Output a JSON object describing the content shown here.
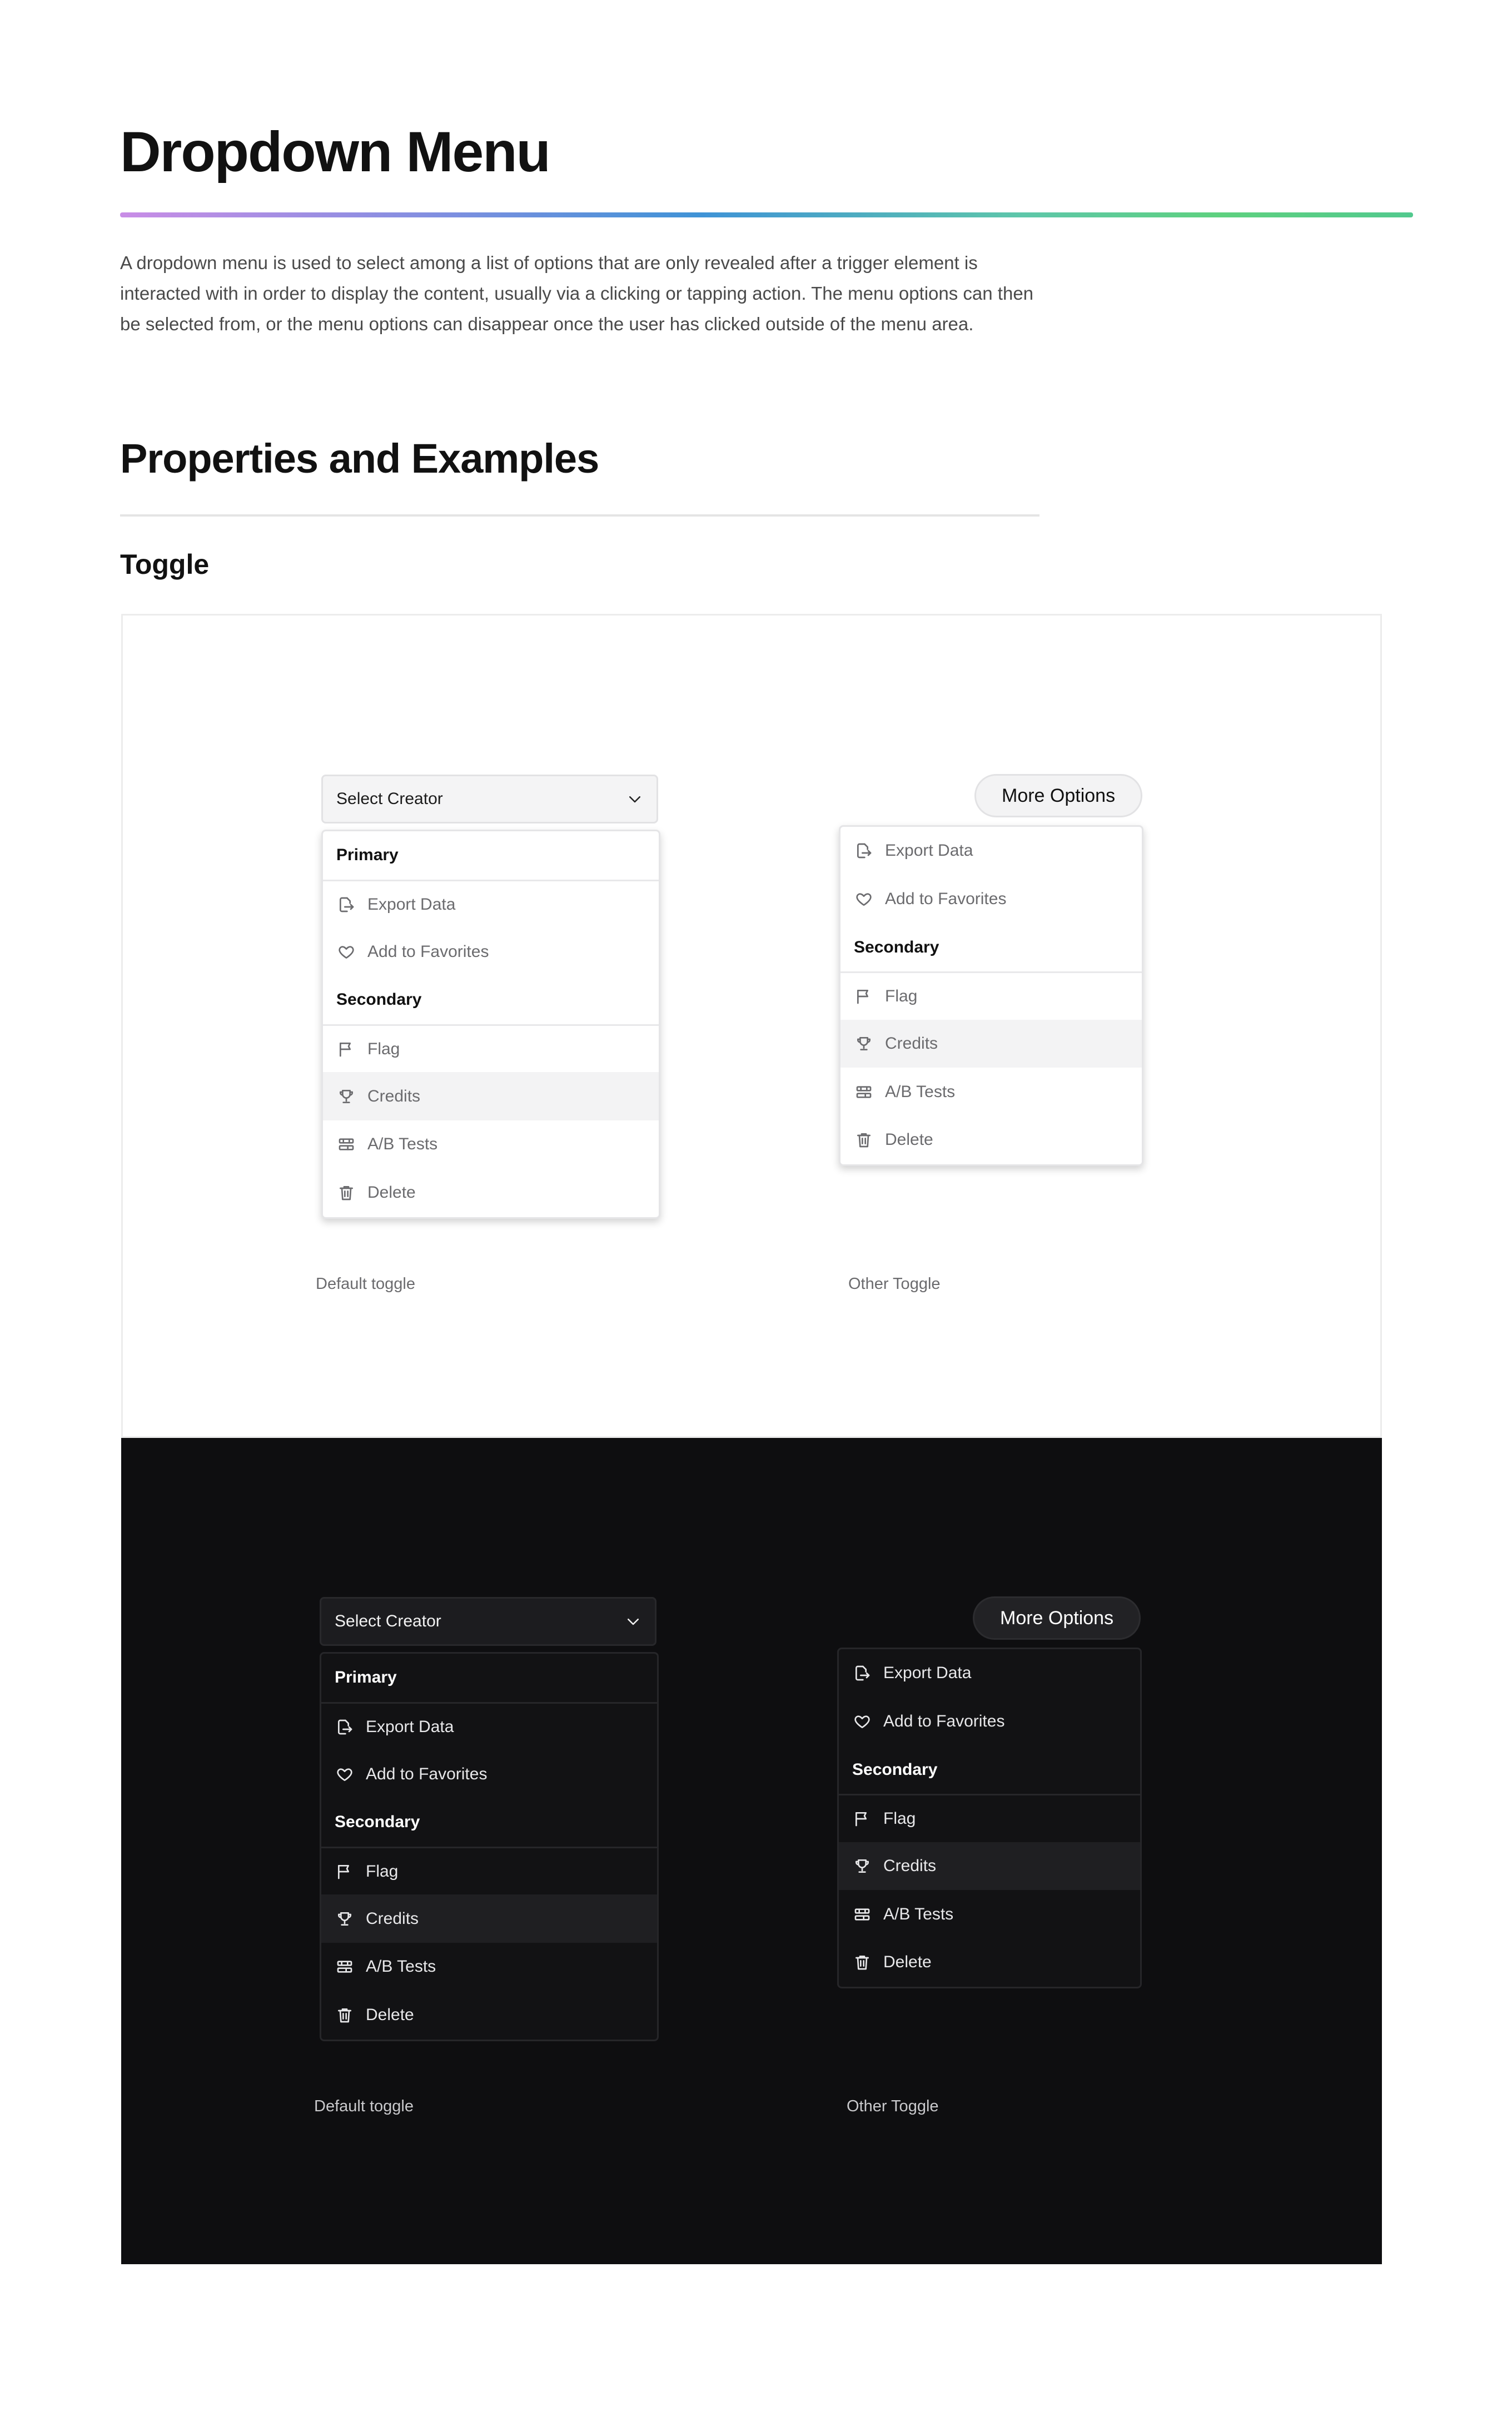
{
  "page": {
    "title": "Dropdown Menu",
    "intro": "A dropdown menu is used to select among a list of options that are only revealed after a trigger element is interacted with in order to display the content, usually via a clicking or tapping action. The menu options can then be selected from, or the menu options can disappear once the user has clicked outside of the menu area.",
    "section_title": "Properties and Examples",
    "subsection_title": "Toggle"
  },
  "default_toggle": {
    "select_label": "Select Creator",
    "menu": [
      {
        "type": "header",
        "label": "Primary"
      },
      {
        "type": "item",
        "label": "Export Data",
        "icon": "export-icon"
      },
      {
        "type": "item",
        "label": "Add to Favorites",
        "icon": "heart-icon"
      },
      {
        "type": "header",
        "label": "Secondary"
      },
      {
        "type": "item",
        "label": "Flag",
        "icon": "flag-icon"
      },
      {
        "type": "item",
        "label": "Credits",
        "icon": "trophy-icon",
        "active": true
      },
      {
        "type": "item",
        "label": "A/B Tests",
        "icon": "ab-tests-icon"
      },
      {
        "type": "item",
        "label": "Delete",
        "icon": "trash-icon"
      }
    ],
    "caption": "Default toggle"
  },
  "other_toggle": {
    "button_label": "More Options",
    "menu": [
      {
        "type": "item",
        "label": "Export Data",
        "icon": "export-icon"
      },
      {
        "type": "item",
        "label": "Add to Favorites",
        "icon": "heart-icon"
      },
      {
        "type": "header",
        "label": "Secondary"
      },
      {
        "type": "item",
        "label": "Flag",
        "icon": "flag-icon"
      },
      {
        "type": "item",
        "label": "Credits",
        "icon": "trophy-icon",
        "active": true
      },
      {
        "type": "item",
        "label": "A/B Tests",
        "icon": "ab-tests-icon"
      },
      {
        "type": "item",
        "label": "Delete",
        "icon": "trash-icon"
      }
    ],
    "caption": "Other Toggle"
  },
  "colors": {
    "light_panel": "#ffffff",
    "dark_panel": "#0e0e10",
    "gradient": [
      "#c98de6",
      "#3f93d6",
      "#5ed17f"
    ]
  }
}
